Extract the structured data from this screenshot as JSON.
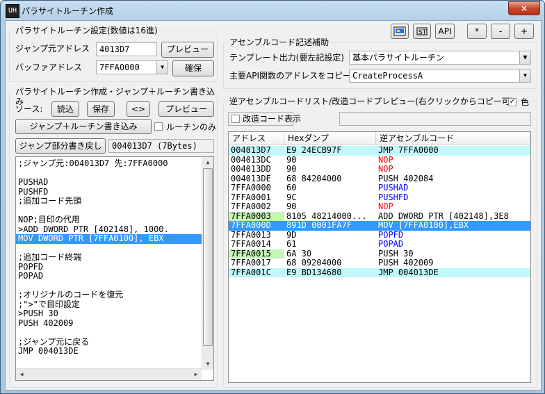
{
  "window": {
    "title": "パラサイトルーチン作成",
    "icon_text": "UH",
    "close": "×"
  },
  "settings_group": {
    "title": "パラサイトルーチン設定(数値は16進)",
    "jump_src_label": "ジャンプ元アドレス",
    "jump_src_value": "4013D7",
    "preview_btn": "プレビュー",
    "buffer_label": "バッファアドレス",
    "buffer_value": "7FFA0000",
    "secure_btn": "確保"
  },
  "create_group": {
    "title": "パラサイトルーチン作成・ジャンプ＋ルーチン書き込み",
    "source_label": "ソース:",
    "load_btn": "読込",
    "save_btn": "保存",
    "swap_btn": "<>",
    "preview_btn": "プレビュー",
    "write_btn": "ジャンプ＋ルーチン書き込み",
    "routine_only_label": "ルーチンのみ",
    "restore_btn": "ジャンプ部分書き戻し",
    "restore_info": "004013D7 (7Bytes)"
  },
  "editor_lines": [
    ";ジャンプ元:004013D7 先:7FFA0000",
    "",
    "PUSHAD",
    "PUSHFD",
    ";追加コード先頭",
    "",
    "NOP;目印の代用",
    ">ADD DWORD PTR [402148], 1000.",
    "MOV DWORD PTR [7FFA0100], EBX",
    "",
    ";追加コード終端",
    "POPFD",
    "POPAD",
    "",
    ";オリジナルのコードを復元",
    ";\">\"で目印設定",
    ">PUSH 30",
    "PUSH 402009",
    "",
    ";ジャンプ元に戻る",
    "JMP 004013DE"
  ],
  "toolbar": {
    "api_btn": "API",
    "star_btn": "*",
    "minus_btn": "-",
    "plus_btn": "+",
    "icon1": "screen-capture-icon",
    "icon2": "asm-tool-icon"
  },
  "asm_group": {
    "title": "アセンブルコード記述補助",
    "template_label": "テンプレート出力(要左記設定)",
    "template_value": "基本パラサイトルーチン",
    "api_label": "主要API関数のアドレスをコピー",
    "api_value": "CreateProcessA"
  },
  "disasm_group": {
    "title": "逆アセンブルコードリスト/改造コードプレビュー(右クリックからコピー可)",
    "color_check": "✓",
    "color_label": "色",
    "show_mod_label": "改造コード表示",
    "headers": [
      "アドレス",
      "Hexダンプ",
      "逆アセンブルコード"
    ]
  },
  "disasm_rows": [
    {
      "addr": "004013D7",
      "hex": "E9 24ECB97F",
      "asm": "JMP 7FFA0000",
      "row_style": "cyan",
      "asm_color": "#000000"
    },
    {
      "addr": "004013DC",
      "hex": "90",
      "asm": "NOP",
      "row_style": "none",
      "asm_color": "#ff0000"
    },
    {
      "addr": "004013DD",
      "hex": "90",
      "asm": "NOP",
      "row_style": "none",
      "asm_color": "#ff0000"
    },
    {
      "addr": "004013DE",
      "hex": "68 84204000",
      "asm": "PUSH 402084",
      "row_style": "none",
      "asm_color": "#000000"
    },
    {
      "addr": "7FFA0000",
      "hex": "60",
      "asm": "PUSHAD",
      "row_style": "none",
      "asm_color": "#0000ff"
    },
    {
      "addr": "7FFA0001",
      "hex": "9C",
      "asm": "PUSHFD",
      "row_style": "none",
      "asm_color": "#0000ff"
    },
    {
      "addr": "7FFA0002",
      "hex": "90",
      "asm": "NOP",
      "row_style": "none",
      "asm_color": "#ff0000"
    },
    {
      "addr": "7FFA0003",
      "hex": "8105 48214000...",
      "asm": "ADD DWORD PTR [402148],3E8",
      "row_style": "green-addr",
      "asm_color": "#000000"
    },
    {
      "addr": "7FFA000D",
      "hex": "891D 0001FA7F",
      "asm": "MOV [7FFA0100],EBX",
      "row_style": "selected",
      "asm_color": "#ffffff"
    },
    {
      "addr": "7FFA0013",
      "hex": "9D",
      "asm": "POPFD",
      "row_style": "none",
      "asm_color": "#0000ff"
    },
    {
      "addr": "7FFA0014",
      "hex": "61",
      "asm": "POPAD",
      "row_style": "none",
      "asm_color": "#0000ff"
    },
    {
      "addr": "7FFA0015",
      "hex": "6A 30",
      "asm": "PUSH 30",
      "row_style": "green-addr",
      "asm_color": "#000000"
    },
    {
      "addr": "7FFA0017",
      "hex": "68 09204000",
      "asm": "PUSH 402009",
      "row_style": "none",
      "asm_color": "#000000"
    },
    {
      "addr": "7FFA001C",
      "hex": "E9 BD134680",
      "asm": "JMP 004013DE",
      "row_style": "cyan",
      "asm_color": "#000000"
    }
  ],
  "colors": {
    "cyan": "#c0f8fc",
    "green": "#c4f4b8",
    "selected": "#3399ff",
    "nop": "#ff0000",
    "blue": "#0000ff"
  }
}
